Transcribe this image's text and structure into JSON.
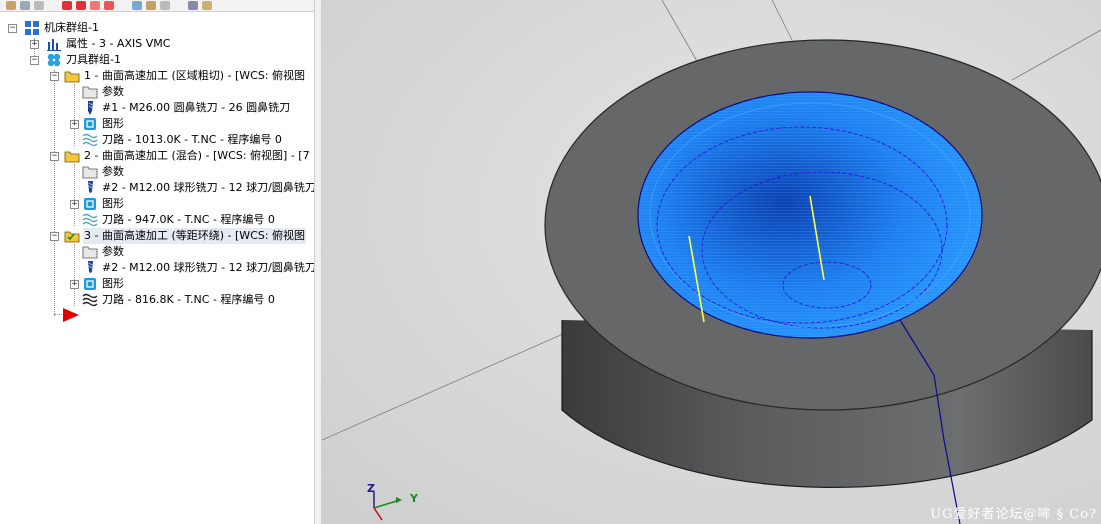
{
  "tree": {
    "root": "机床群组-1",
    "properties": "属性 - 3 - AXIS VMC",
    "tool_group": "刀具群组-1",
    "ops": [
      {
        "title": "1 - 曲面高速加工 (区域粗切) - [WCS: 俯视图",
        "params": "参数",
        "tool": "#1 - M26.00 圆鼻铣刀 - 26 圆鼻铣刀",
        "geometry": "图形",
        "toolpath": "刀路 - 1013.0K - T.NC - 程序编号 0"
      },
      {
        "title": "2 - 曲面高速加工 (混合) - [WCS: 俯视图] - [7",
        "params": "参数",
        "tool": "#2 - M12.00 球形铣刀 - 12 球刀/圆鼻铣刀",
        "geometry": "图形",
        "toolpath": "刀路 - 947.0K - T.NC - 程序编号 0"
      },
      {
        "title": "3 - 曲面高速加工 (等距环绕) - [WCS: 俯视图",
        "params": "参数",
        "tool": "#2 - M12.00 球形铣刀 - 12 球刀/圆鼻铣刀",
        "geometry": "图形",
        "toolpath": "刀路 - 816.8K - T.NC - 程序编号 0"
      }
    ],
    "selected_op": 3
  },
  "viewport": {
    "axis_z": "Z",
    "axis_y": "Y",
    "watermark": "UG爱好者论坛@哞 § Co?",
    "colors": {
      "background": "#d9d9d9",
      "part": "#646668",
      "toolpath": "#1f8bff",
      "contour": "#0000a0",
      "tool_axis": "#ffff40"
    }
  }
}
